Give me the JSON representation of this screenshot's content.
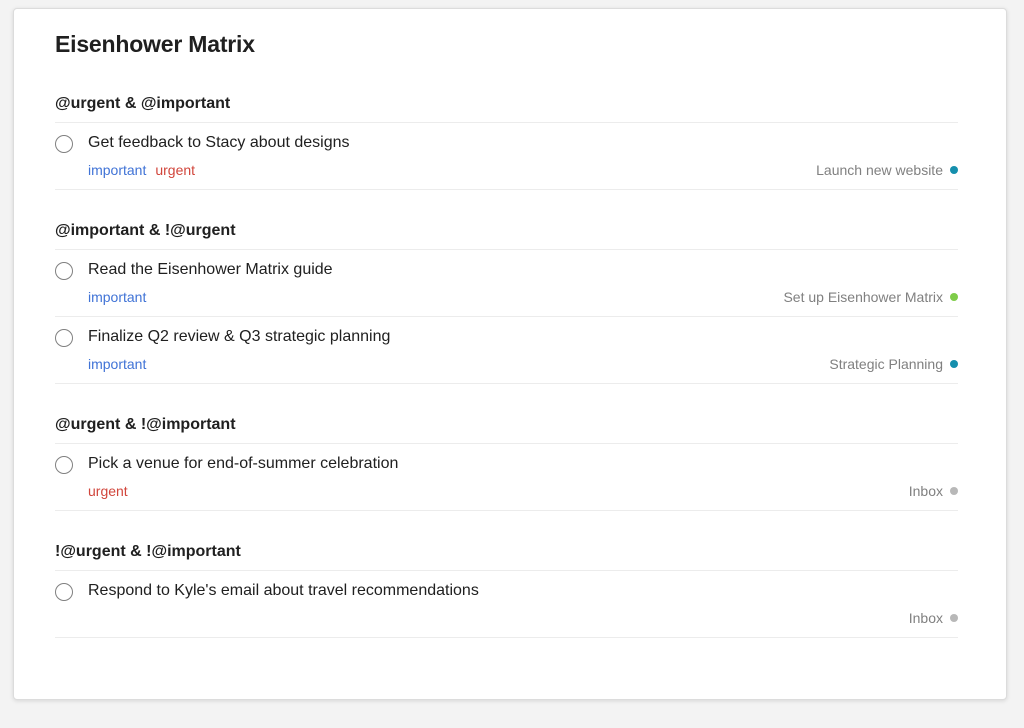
{
  "page": {
    "title": "Eisenhower Matrix"
  },
  "colors": {
    "label_important": "#4073d6",
    "label_urgent": "#d1453b",
    "project_teal": "#158fad",
    "project_green": "#7ecc49",
    "project_grey": "#b8b8b8"
  },
  "sections": [
    {
      "title": "@urgent & @important",
      "tasks": [
        {
          "content": "Get feedback to Stacy about designs",
          "labels": [
            "important",
            "urgent"
          ],
          "project": {
            "name": "Launch new website",
            "color": "#158fad"
          }
        }
      ]
    },
    {
      "title": "@important & !@urgent",
      "tasks": [
        {
          "content": "Read the Eisenhower Matrix guide",
          "labels": [
            "important"
          ],
          "project": {
            "name": "Set up Eisenhower Matrix",
            "color": "#7ecc49"
          }
        },
        {
          "content": "Finalize Q2 review & Q3 strategic planning",
          "labels": [
            "important"
          ],
          "project": {
            "name": "Strategic Planning",
            "color": "#158fad"
          }
        }
      ]
    },
    {
      "title": "@urgent & !@important",
      "tasks": [
        {
          "content": "Pick a venue for end-of-summer celebration",
          "labels": [
            "urgent"
          ],
          "project": {
            "name": "Inbox",
            "color": "#b8b8b8"
          }
        }
      ]
    },
    {
      "title": "!@urgent & !@important",
      "tasks": [
        {
          "content": "Respond to Kyle's email about travel recommendations",
          "labels": [],
          "project": {
            "name": "Inbox",
            "color": "#b8b8b8"
          }
        }
      ]
    }
  ]
}
